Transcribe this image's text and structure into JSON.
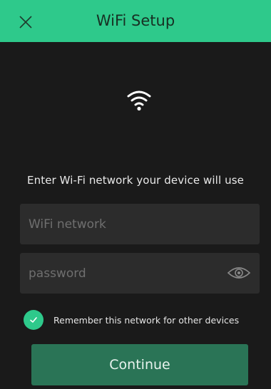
{
  "header": {
    "title": "WiFi Setup",
    "close_icon": "close-icon",
    "background_color": "#2ec98b"
  },
  "main": {
    "wifi_icon": "wifi-icon",
    "instruction": "Enter Wi-Fi network your device will use",
    "network_field": {
      "placeholder": "WiFi network",
      "value": ""
    },
    "password_field": {
      "placeholder": "password",
      "value": "",
      "toggle_icon": "eye-icon"
    },
    "remember": {
      "checked": true,
      "label": "Remember this network for other devices"
    },
    "continue_label": "Continue"
  },
  "colors": {
    "background": "#1a1a1a",
    "accent": "#2ec98b",
    "button": "#2a7456",
    "field": "#2c2c2c"
  }
}
